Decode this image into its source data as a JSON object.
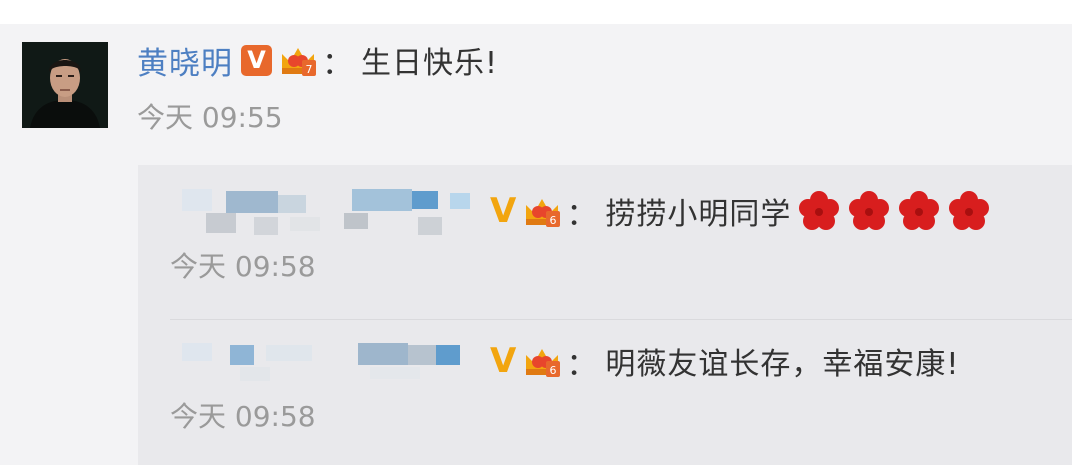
{
  "top_comment": {
    "username": "黄晓明",
    "verified_icon": "verified-v-icon",
    "member_icon": "crown-badge-icon",
    "separator": "：",
    "text": "生日快乐!",
    "timestamp": "今天 09:55"
  },
  "replies": [
    {
      "username_visible": false,
      "verified_icon": "verified-v-icon",
      "member_icon": "crown-badge-icon",
      "separator": "：",
      "text": "捞捞小明同学",
      "emoji": [
        "plum-blossom-icon",
        "plum-blossom-icon",
        "plum-blossom-icon",
        "plum-blossom-icon"
      ],
      "timestamp": "今天 09:58"
    },
    {
      "username_visible": false,
      "verified_icon": "verified-v-icon",
      "member_icon": "crown-badge-icon",
      "separator": "：",
      "text": "明薇友谊长存，幸福安康!",
      "timestamp": "今天 09:58"
    }
  ],
  "colors": {
    "username": "#4d7fc2",
    "timestamp": "#9a9a9a",
    "badge_orange": "#e8682c",
    "v_gold": "#f2a50f",
    "flower_red": "#d81e1e",
    "reply_bg": "#e9e9ec"
  }
}
